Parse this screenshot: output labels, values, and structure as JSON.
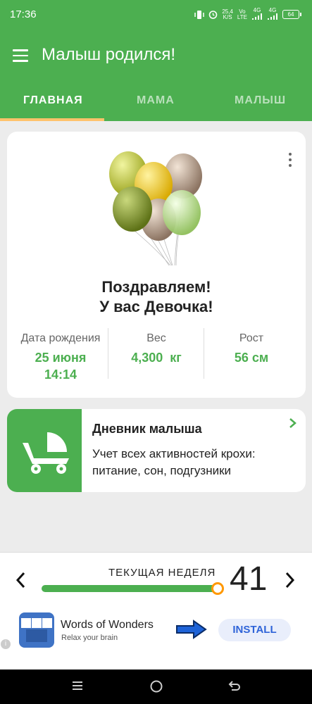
{
  "status_bar": {
    "time": "17:36",
    "speed_top": "25,4",
    "speed_unit": "K/S",
    "volte_top": "Vo",
    "volte_bottom": "LTE",
    "net1": "4G",
    "net2": "4G",
    "battery": "64"
  },
  "app_bar": {
    "title": "Малыш родился!",
    "menu_icon": "hamburger-icon"
  },
  "tabs": [
    {
      "label": "ГЛАВНАЯ",
      "active": true
    },
    {
      "label": "МАМА",
      "active": false
    },
    {
      "label": "МАЛЫШ",
      "active": false
    }
  ],
  "baby_card": {
    "congrats_line1": "Поздравляем!",
    "congrats_line2": "У вас Девочка!",
    "birth_label": "Дата рождения",
    "birth_date": "25 июня",
    "birth_time": "14:14",
    "weight_label": "Вес",
    "weight_value": "4,300  кг",
    "height_label": "Рост",
    "height_value": "56 см"
  },
  "diary_card": {
    "title": "Дневник малыша",
    "description": "Учет всех активностей крохи: питание, сон, подгузники",
    "icon": "stroller-icon"
  },
  "week": {
    "label": "ТЕКУЩАЯ НЕДЕЛЯ",
    "number": "41",
    "progress": 1.0
  },
  "ad": {
    "title": "Words of Wonders",
    "subtitle": "Relax your brain",
    "install_label": "INSTALL",
    "info": "i",
    "icon_letters": "W O W"
  },
  "colors": {
    "primary": "#4caf50",
    "accent": "#ff9800",
    "tab_indicator": "#ffc26b"
  }
}
